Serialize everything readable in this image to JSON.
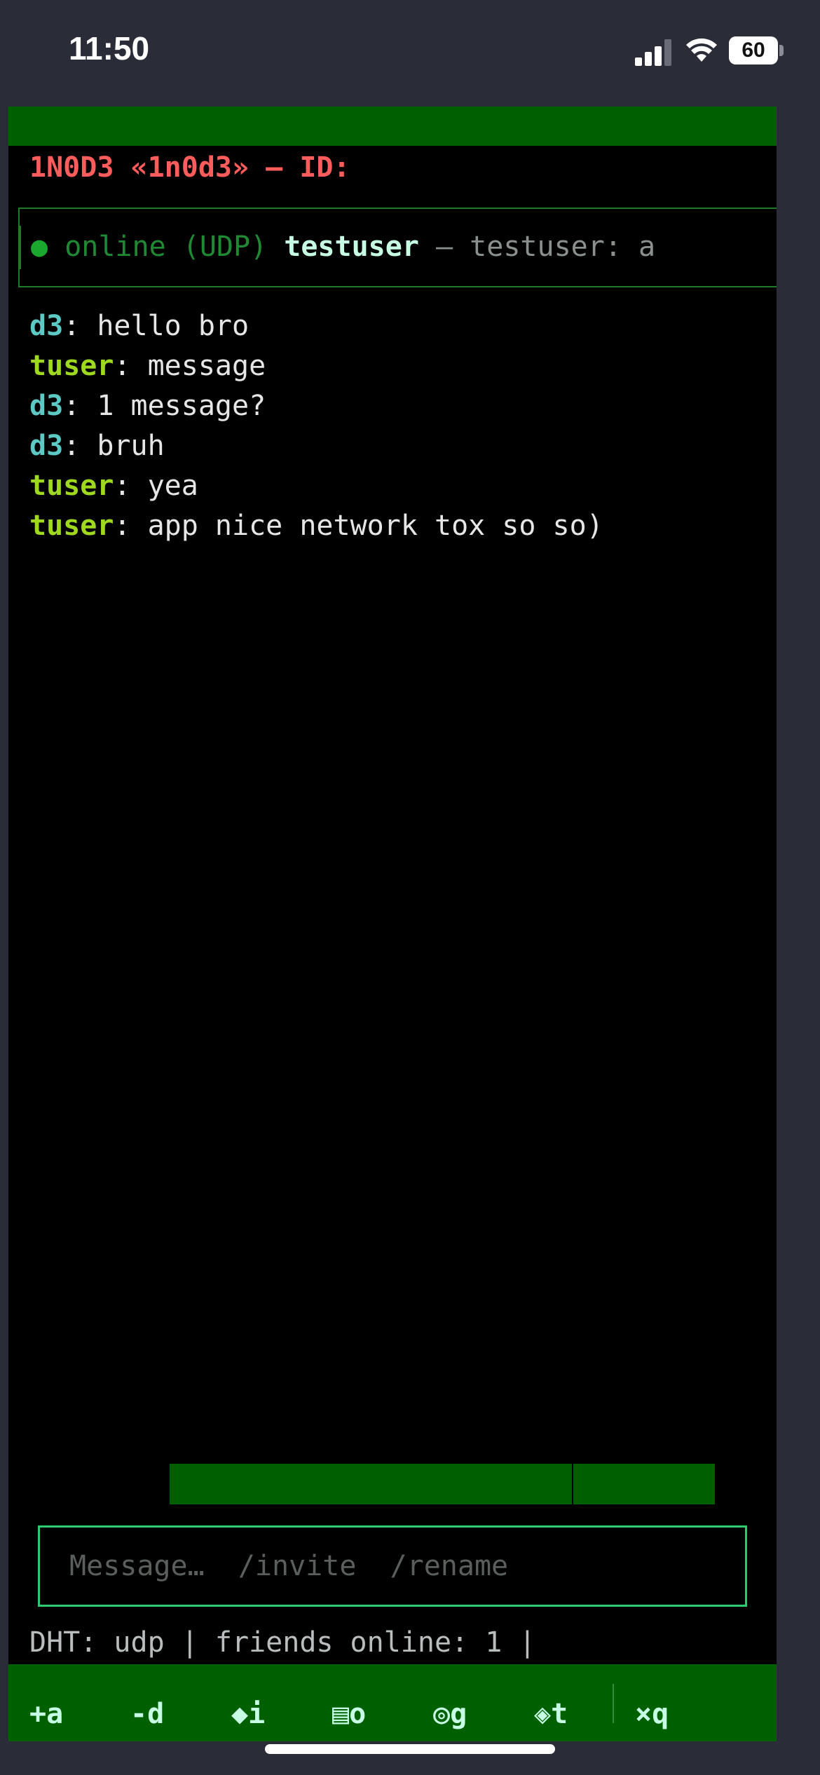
{
  "status_bar": {
    "time": "11:50",
    "battery": "60",
    "battery_level": 0.6,
    "signal_bars": 3
  },
  "header": {
    "title": "1N0D3 «1n0d3» — ID:"
  },
  "contact": {
    "dot": "●",
    "status": "online (UDP)",
    "name": "testuser",
    "preview": " — testuser: a"
  },
  "messages": [
    {
      "sender": "d3",
      "text": ": hello bro"
    },
    {
      "sender": "tuser",
      "text": ": message"
    },
    {
      "sender": "d3",
      "text": ": 1 message?"
    },
    {
      "sender": "d3",
      "text": ": bruh"
    },
    {
      "sender": "tuser",
      "text": ": yea"
    },
    {
      "sender": "tuser",
      "text": ": app nice network tox so so)"
    }
  ],
  "composer": {
    "placeholder": "Message…  /invite  /rename"
  },
  "status_line": {
    "text": "DHT: udp | friends online: 1 |"
  },
  "shortcuts": [
    {
      "label": "+a",
      "name": "add"
    },
    {
      "label": "-d",
      "name": "delete"
    },
    {
      "label": "◆i",
      "name": "info"
    },
    {
      "label": "▤o",
      "name": "open"
    },
    {
      "label": "◎g",
      "name": "group"
    },
    {
      "label": "◈t",
      "name": "theme"
    },
    {
      "label": "×q",
      "name": "quit"
    }
  ],
  "colors": {
    "green_bar": "#006000",
    "title_red": "#ff5c5c",
    "d3_cyan": "#5cc9c5",
    "tuser_lime": "#9fd91f",
    "input_border": "#2ecc71"
  }
}
